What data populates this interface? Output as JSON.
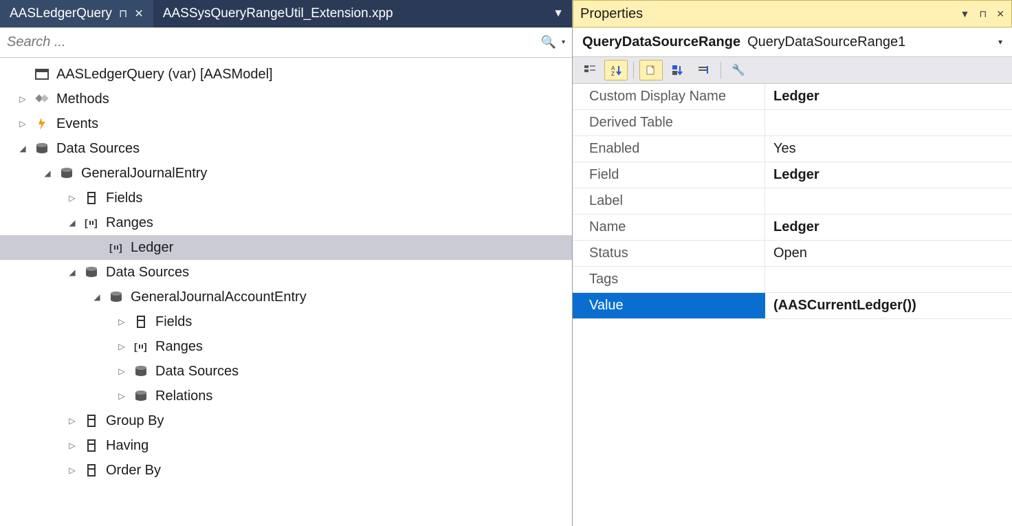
{
  "tabs": {
    "active": "AASLedgerQuery",
    "inactive": "AASSysQueryRangeUtil_Extension.xpp"
  },
  "search": {
    "placeholder": "Search ..."
  },
  "tree": [
    {
      "d": 0,
      "exp": "",
      "icon": "window",
      "label": "AASLedgerQuery (var) [AASModel]"
    },
    {
      "d": 0,
      "exp": "right",
      "icon": "methods",
      "label": "Methods"
    },
    {
      "d": 0,
      "exp": "right",
      "icon": "event",
      "label": "Events"
    },
    {
      "d": 0,
      "exp": "down",
      "icon": "db",
      "label": "Data Sources"
    },
    {
      "d": 1,
      "exp": "down",
      "icon": "db",
      "label": "GeneralJournalEntry"
    },
    {
      "d": 2,
      "exp": "right",
      "icon": "field",
      "label": "Fields"
    },
    {
      "d": 2,
      "exp": "down",
      "icon": "range",
      "label": "Ranges"
    },
    {
      "d": 3,
      "exp": "",
      "icon": "range",
      "label": "Ledger",
      "selected": true
    },
    {
      "d": 2,
      "exp": "down",
      "icon": "db",
      "label": "Data Sources"
    },
    {
      "d": 3,
      "exp": "down",
      "icon": "db",
      "label": "GeneralJournalAccountEntry"
    },
    {
      "d": 4,
      "exp": "right",
      "icon": "field",
      "label": "Fields"
    },
    {
      "d": 4,
      "exp": "right",
      "icon": "range",
      "label": "Ranges"
    },
    {
      "d": 4,
      "exp": "right",
      "icon": "db",
      "label": "Data Sources"
    },
    {
      "d": 4,
      "exp": "right",
      "icon": "db",
      "label": "Relations"
    },
    {
      "d": 2,
      "exp": "right",
      "icon": "field",
      "label": "Group By"
    },
    {
      "d": 2,
      "exp": "right",
      "icon": "field",
      "label": "Having"
    },
    {
      "d": 2,
      "exp": "right",
      "icon": "field",
      "label": "Order By"
    }
  ],
  "propertiesPanel": {
    "title": "Properties",
    "objectType": "QueryDataSourceRange",
    "objectName": "QueryDataSourceRange1"
  },
  "properties": [
    {
      "name": "Custom Display Name",
      "value": "Ledger",
      "bold": true
    },
    {
      "name": "Derived Table",
      "value": ""
    },
    {
      "name": "Enabled",
      "value": "Yes"
    },
    {
      "name": "Field",
      "value": "Ledger",
      "bold": true
    },
    {
      "name": "Label",
      "value": ""
    },
    {
      "name": "Name",
      "value": "Ledger",
      "bold": true
    },
    {
      "name": "Status",
      "value": "Open"
    },
    {
      "name": "Tags",
      "value": ""
    },
    {
      "name": "Value",
      "value": "(AASCurrentLedger())",
      "bold": true,
      "selected": true
    }
  ]
}
